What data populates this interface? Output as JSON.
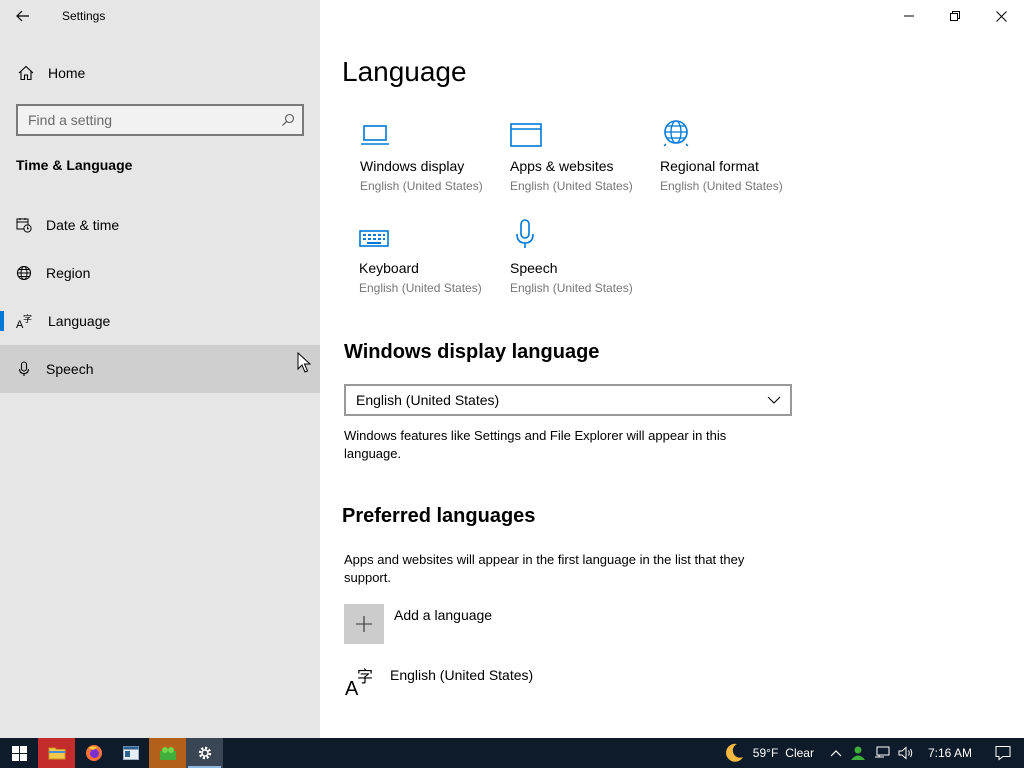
{
  "window": {
    "title": "Settings",
    "controls": {
      "minimize": "minimize",
      "maximize": "restore",
      "close": "close"
    }
  },
  "sidebar": {
    "home_label": "Home",
    "search": {
      "placeholder": "Find a setting",
      "value": ""
    },
    "section_title": "Time & Language",
    "items": [
      {
        "label": "Date & time",
        "icon": "calendar-clock-icon"
      },
      {
        "label": "Region",
        "icon": "globe-icon"
      },
      {
        "label": "Language",
        "icon": "language-icon",
        "selected": true
      },
      {
        "label": "Speech",
        "icon": "microphone-icon",
        "hovered": true
      }
    ]
  },
  "main": {
    "title": "Language",
    "tiles": [
      {
        "name": "Windows display",
        "sub": "English (United States)",
        "icon": "laptop-icon"
      },
      {
        "name": "Apps & websites",
        "sub": "English (United States)",
        "icon": "browser-window-icon"
      },
      {
        "name": "Regional format",
        "sub": "English (United States)",
        "icon": "globe-icon"
      },
      {
        "name": "Keyboard",
        "sub": "English (United States)",
        "icon": "keyboard-icon"
      },
      {
        "name": "Speech",
        "sub": "English (United States)",
        "icon": "microphone-icon"
      }
    ],
    "display_language": {
      "heading": "Windows display language",
      "selected": "English (United States)",
      "description": "Windows features like Settings and File Explorer will appear in this language."
    },
    "preferred": {
      "heading": "Preferred languages",
      "description": "Apps and websites will appear in the first language in the list that they support.",
      "add_label": "Add a language",
      "languages": [
        "English (United States)"
      ]
    }
  },
  "taskbar": {
    "weather": {
      "temp": "59°F",
      "condition": "Clear"
    },
    "time": "7:16 AM",
    "accent": "#0078d7"
  }
}
